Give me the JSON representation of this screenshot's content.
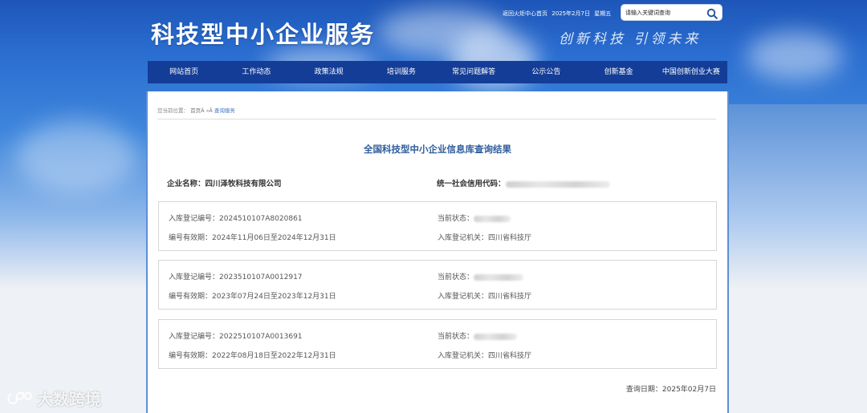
{
  "header": {
    "site_title": "科技型中小企业服务",
    "top_links": {
      "home_link": "返回火炬中心首页",
      "date": "2025年2月7日",
      "weekday": "星期五"
    },
    "search": {
      "placeholder": "请输入关键词查询"
    },
    "slogan": "创新科技 引领未来"
  },
  "nav": {
    "items": [
      {
        "label": "网站首页"
      },
      {
        "label": "工作动态"
      },
      {
        "label": "政策法规"
      },
      {
        "label": "培训服务"
      },
      {
        "label": "常见问题解答"
      },
      {
        "label": "公示公告"
      },
      {
        "label": "创新基金"
      },
      {
        "label": "中国创新创业大赛"
      }
    ]
  },
  "breadcrumb": {
    "prefix": "您当前位置：",
    "home": "首页Â »Â",
    "current": "查询服务"
  },
  "result": {
    "title": "全国科技型中小企业信息库查询结果",
    "company_label": "企业名称：",
    "company_name": "四川泽牧科技有限公司",
    "credit_code_label": "统一社会信用代码："
  },
  "records": [
    {
      "reg_no_label": "入库登记编号：",
      "reg_no": "2024510107A8020861",
      "validity_label": "编号有效期：",
      "validity": "2024年11月06日至2024年12月31日",
      "status_label": "当前状态：",
      "authority_label": "入库登记机关：",
      "authority": "四川省科技厅"
    },
    {
      "reg_no_label": "入库登记编号：",
      "reg_no": "2023510107A0012917",
      "validity_label": "编号有效期：",
      "validity": "2023年07月24日至2023年12月31日",
      "status_label": "当前状态：",
      "authority_label": "入库登记机关：",
      "authority": "四川省科技厅"
    },
    {
      "reg_no_label": "入库登记编号：",
      "reg_no": "2022510107A0013691",
      "validity_label": "编号有效期：",
      "validity": "2022年08月18日至2022年12月31日",
      "status_label": "当前状态：",
      "authority_label": "入库登记机关：",
      "authority": "四川省科技厅"
    }
  ],
  "query_date": {
    "label": "查询日期：",
    "value": "2025年02月7日"
  },
  "watermark": {
    "text": "大数跨境"
  },
  "colors": {
    "nav_bg": "#143d97",
    "title_blue": "#2f5d9c",
    "breadcrumb_link": "#3f76bf"
  }
}
